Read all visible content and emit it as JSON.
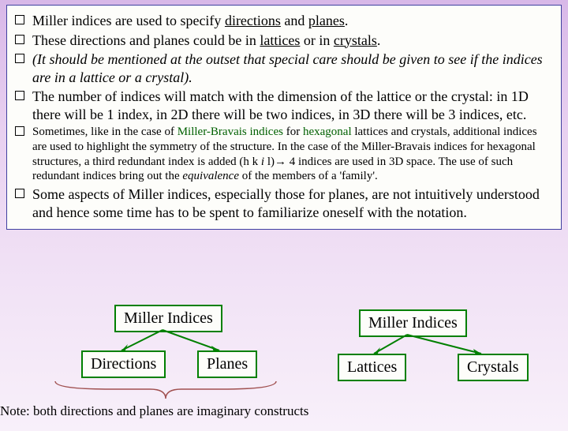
{
  "bullets": {
    "b1_a": "Miller indices are used to specify ",
    "b1_b": "directions",
    "b1_c": " and ",
    "b1_d": "planes",
    "b1_e": ".",
    "b2_a": "These directions and planes could be in ",
    "b2_b": "lattices",
    "b2_c": " or in ",
    "b2_d": "crystals",
    "b2_e": ".",
    "b3": "(It should be mentioned at the outset that special care should be given to see if the indices are in a lattice or a crystal).",
    "b4": "The number of indices will match with the dimension of the lattice or the crystal: in 1D there will be 1 index, in 2D there will be two indices, in 3D there will be 3 indices, etc.",
    "b5_a": "Sometimes, like in the case of ",
    "b5_b": "Miller-Bravais indices",
    "b5_c": " for ",
    "b5_d": "hexagonal",
    "b5_e": " lattices and crystals, additional indices are used to highlight the symmetry of the structure. In the case of the Miller-Bravais indices for hexagonal structures, a third redundant index is added (h k ",
    "b5_f": "i",
    "b5_g": " l)→ 4 indices are used in 3D space. The use of such redundant indices bring out the ",
    "b5_h": "equivalence",
    "b5_i": " of the members of a 'family'.",
    "b6": "Some aspects of Miller indices, especially those for planes, are not intuitively understood and hence some time has to be spent to familiarize oneself with the notation."
  },
  "boxes": {
    "mi1": "Miller Indices",
    "directions": "Directions",
    "planes": "Planes",
    "mi2": "Miller Indices",
    "lattices": "Lattices",
    "crystals": "Crystals"
  },
  "note": "Note: both directions and planes are imaginary constructs"
}
